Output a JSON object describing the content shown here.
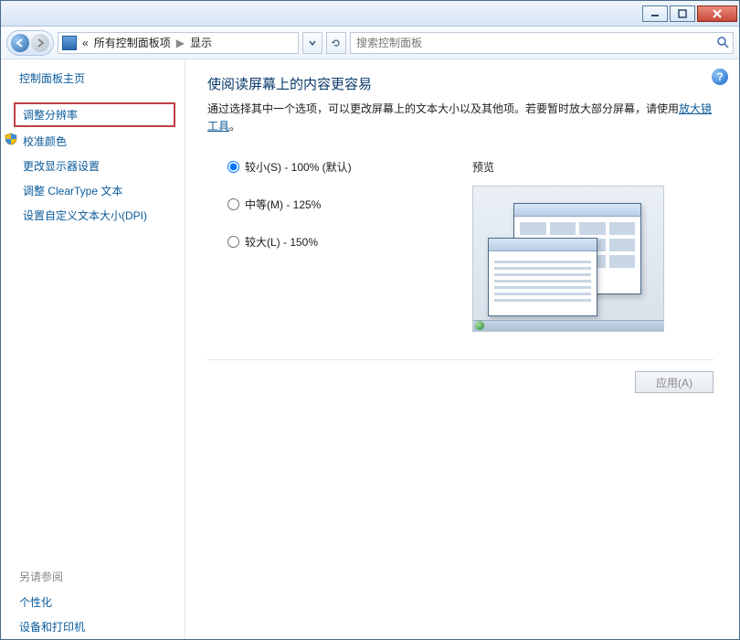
{
  "breadcrumb": {
    "level1": "所有控制面板项",
    "level2": "显示",
    "prefix": "«"
  },
  "search": {
    "placeholder": "搜索控制面板"
  },
  "sidebar": {
    "home": "控制面板主页",
    "items": [
      "调整分辨率",
      "校准颜色",
      "更改显示器设置",
      "调整 ClearType 文本",
      "设置自定义文本大小(DPI)"
    ],
    "see_also_header": "另请参阅",
    "see_also": [
      "个性化",
      "设备和打印机"
    ]
  },
  "main": {
    "heading": "使阅读屏幕上的内容更容易",
    "desc_pre": "通过选择其中一个选项，可以更改屏幕上的文本大小以及其他项。若要暂时放大部分屏幕，请使用",
    "desc_link": "放大镜工具",
    "desc_post": "。",
    "options": [
      {
        "label": "较小(S) - 100% (默认)",
        "checked": true
      },
      {
        "label": "中等(M) - 125%",
        "checked": false
      },
      {
        "label": "较大(L) - 150%",
        "checked": false
      }
    ],
    "preview_label": "预览",
    "apply": "应用(A)"
  }
}
